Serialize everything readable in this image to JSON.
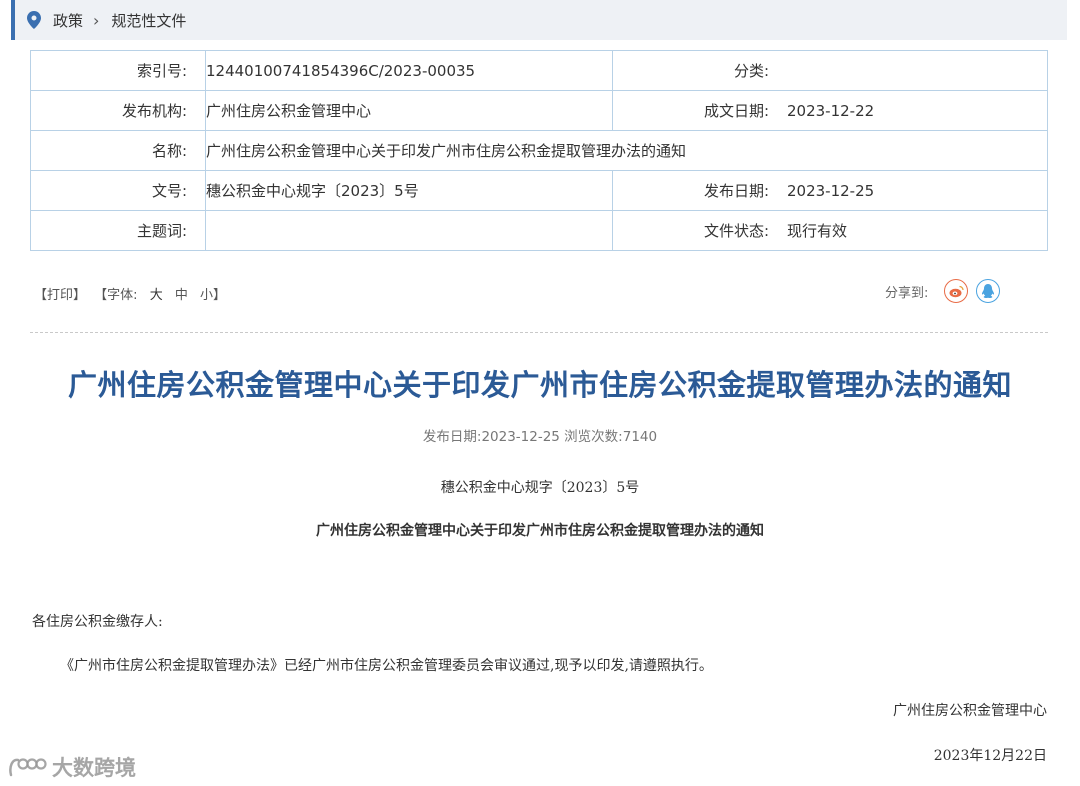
{
  "breadcrumb": {
    "items": [
      "政策",
      "规范性文件"
    ],
    "separator": "›"
  },
  "meta": {
    "index_label": "索引号:",
    "index_value": "12440100741854396C/2023-00035",
    "category_label": "分类:",
    "category_value": "",
    "publisher_label": "发布机构:",
    "publisher_value": "广州住房公积金管理中心",
    "written_date_label": "成文日期:",
    "written_date_value": "2023-12-22",
    "name_label": "名称:",
    "name_value": "广州住房公积金管理中心关于印发广州市住房公积金提取管理办法的通知",
    "docno_label": "文号:",
    "docno_value": "穗公积金中心规字〔2023〕5号",
    "pub_date_label": "发布日期:",
    "pub_date_value": "2023-12-25",
    "keywords_label": "主题词:",
    "keywords_value": "",
    "status_label": "文件状态:",
    "status_value": "现行有效"
  },
  "tools": {
    "print": "【打印】",
    "font_open": "【字体:",
    "font_large": "大",
    "font_medium": "中",
    "font_small": "小】"
  },
  "share": {
    "label": "分享到:",
    "icons": [
      "weibo-icon",
      "qq-icon"
    ]
  },
  "article": {
    "title": "广州住房公积金管理中心关于印发广州市住房公积金提取管理办法的通知",
    "pub_info": "发布日期:2023-12-25 浏览次数:7140",
    "doc_number": "穗公积金中心规字〔2023〕5号",
    "subtitle": "广州住房公积金管理中心关于印发广州市住房公积金提取管理办法的通知",
    "salutation": "各住房公积金缴存人:",
    "paragraph": "《广州市住房公积金提取管理办法》已经广州市住房公积金管理委员会审议通过,现予以印发,请遵照执行。",
    "signature": "广州住房公积金管理中心",
    "date": "2023年12月22日"
  },
  "watermark": {
    "text": "大数跨境"
  },
  "colors": {
    "accent": "#2b5a96",
    "border": "#b8d1e6",
    "breadcrumb_bg": "#eef1f5",
    "weibo": "#e86b46",
    "qq": "#4aa3e0"
  }
}
